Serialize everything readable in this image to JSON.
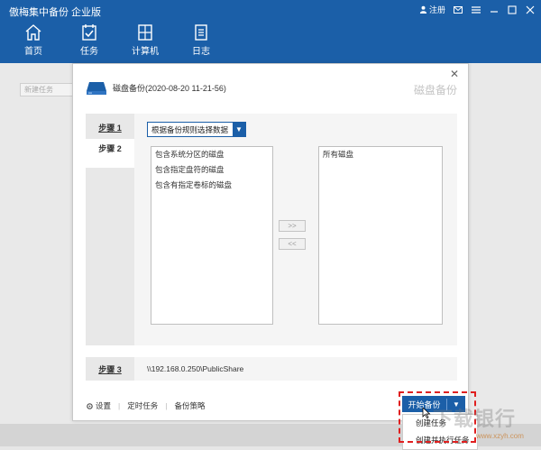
{
  "app": {
    "title": "傲梅集中备份 企业版",
    "user_label": "注册"
  },
  "nav": [
    {
      "label": "首页",
      "icon": "home-icon"
    },
    {
      "label": "任务",
      "icon": "task-icon"
    },
    {
      "label": "计算机",
      "icon": "computer-icon"
    },
    {
      "label": "日志",
      "icon": "log-icon"
    }
  ],
  "background": {
    "new_task_placeholder": "新建任务"
  },
  "dialog": {
    "title": "磁盘备份(2020-08-20 11-21-56)",
    "watermark": "磁盘备份",
    "steps": {
      "step1": "步骤 1",
      "step2": "步骤 2",
      "step3": "步骤 3"
    },
    "rule_select": {
      "value": "根据备份规则选择数据"
    },
    "left_list": [
      "包含系统分区的磁盘",
      "包含指定盘符的磁盘",
      "包含有指定卷标的磁盘"
    ],
    "right_list": [
      "所有磁盘"
    ],
    "move_right": ">>",
    "move_left": "<<",
    "destination": "\\\\192.168.0.250\\PublicShare",
    "footer": {
      "settings": "设置",
      "schedule": "定时任务",
      "strategy": "备份策略"
    },
    "start_button": "开始备份",
    "dropdown": [
      "创建任务",
      "创建并执行任务"
    ]
  },
  "watermark_brand": {
    "text": "下载银行",
    "sub": "www.xzyh.com"
  },
  "colors": {
    "accent": "#1b5fa8",
    "highlight": "#e02020"
  }
}
